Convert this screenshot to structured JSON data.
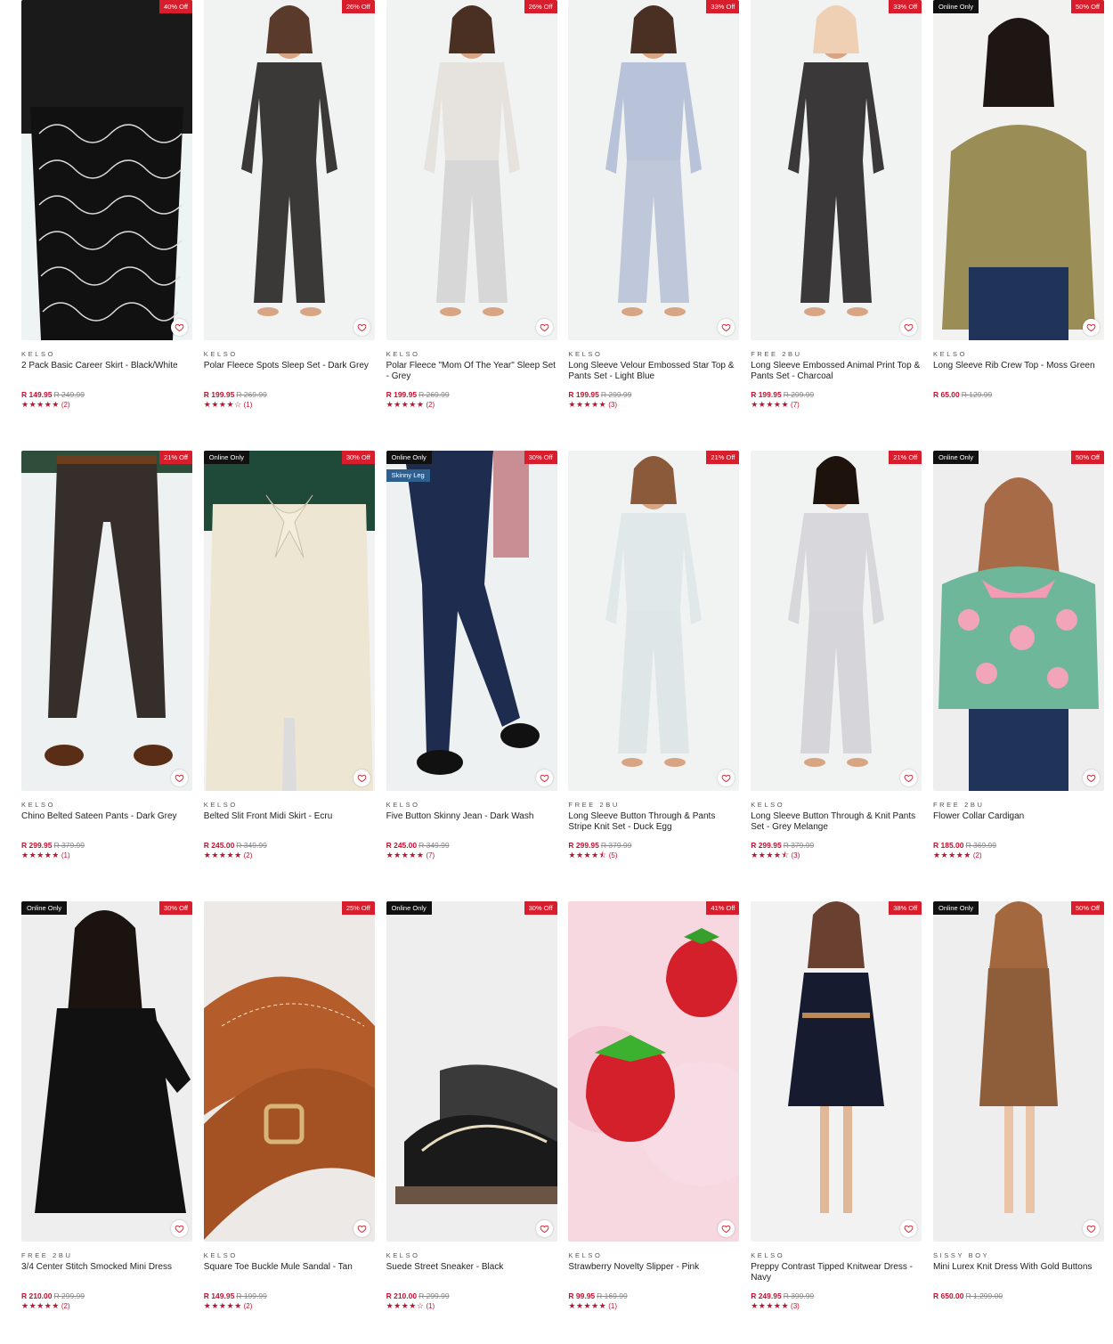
{
  "wishlist_icon": "heart-outline-icon",
  "rating_icon": "star-icon",
  "colors": {
    "sale_red": "#d81e2c",
    "price_red": "#c8102e",
    "online_black": "#111111",
    "tag_blue": "#2f5f8f"
  },
  "products": [
    {
      "brand": "KELSO",
      "name": "2 Pack Basic Career Skirt - Black/White",
      "price": "R 149.95",
      "was": "R 249.99",
      "discount": "40% Off",
      "online_only": false,
      "tag": "",
      "stars": 5,
      "reviews": "(2)"
    },
    {
      "brand": "KELSO",
      "name": "Polar Fleece Spots Sleep Set - Dark Grey",
      "price": "R 199.95",
      "was": "R 269.99",
      "discount": "26% Off",
      "online_only": false,
      "tag": "",
      "stars": 4,
      "reviews": "(1)"
    },
    {
      "brand": "KELSO",
      "name": "Polar Fleece \"Mom Of The Year\" Sleep Set - Grey",
      "price": "R 199.95",
      "was": "R 269.99",
      "discount": "26% Off",
      "online_only": false,
      "tag": "",
      "stars": 5,
      "reviews": "(2)"
    },
    {
      "brand": "KELSO",
      "name": "Long Sleeve Velour Embossed Star Top & Pants Set - Light Blue",
      "price": "R 199.95",
      "was": "R 299.99",
      "discount": "33% Off",
      "online_only": false,
      "tag": "",
      "stars": 5,
      "reviews": "(3)"
    },
    {
      "brand": "FREE 2BU",
      "name": "Long Sleeve Embossed Animal Print Top & Pants Set - Charcoal",
      "price": "R 199.95",
      "was": "R 299.99",
      "discount": "33% Off",
      "online_only": false,
      "tag": "",
      "stars": 5,
      "reviews": "(7)"
    },
    {
      "brand": "KELSO",
      "name": "Long Sleeve Rib Crew Top - Moss Green",
      "price": "R 65.00",
      "was": "R 129.99",
      "discount": "50% Off",
      "online_only": true,
      "tag": "",
      "stars": null,
      "reviews": ""
    },
    {
      "brand": "KELSO",
      "name": "Chino Belted Sateen Pants - Dark Grey",
      "price": "R 299.95",
      "was": "R 379.99",
      "discount": "21% Off",
      "online_only": false,
      "tag": "",
      "stars": 5,
      "reviews": "(1)"
    },
    {
      "brand": "KELSO",
      "name": "Belted Slit Front Midi Skirt - Ecru",
      "price": "R 245.00",
      "was": "R 349.99",
      "discount": "30% Off",
      "online_only": true,
      "tag": "",
      "stars": 5,
      "reviews": "(2)"
    },
    {
      "brand": "KELSO",
      "name": "Five Button Skinny Jean - Dark Wash",
      "price": "R 245.00",
      "was": "R 349.99",
      "discount": "30% Off",
      "online_only": true,
      "tag": "Skinny Leg",
      "stars": 5,
      "reviews": "(7)"
    },
    {
      "brand": "FREE 2BU",
      "name": "Long Sleeve Button Through & Pants Stripe Knit Set - Duck Egg",
      "price": "R 299.95",
      "was": "R 379.99",
      "discount": "21% Off",
      "online_only": false,
      "tag": "",
      "stars": 4.5,
      "reviews": "(5)"
    },
    {
      "brand": "KELSO",
      "name": "Long Sleeve Button Through & Knit Pants Set - Grey Melange",
      "price": "R 299.95",
      "was": "R 379.99",
      "discount": "21% Off",
      "online_only": false,
      "tag": "",
      "stars": 4.5,
      "reviews": "(3)"
    },
    {
      "brand": "FREE 2BU",
      "name": "Flower Collar Cardigan",
      "price": "R 185.00",
      "was": "R 369.99",
      "discount": "50% Off",
      "online_only": true,
      "tag": "",
      "stars": 5,
      "reviews": "(2)"
    },
    {
      "brand": "FREE 2BU",
      "name": "3/4 Center Stitch Smocked Mini Dress",
      "price": "R 210.00",
      "was": "R 299.99",
      "discount": "30% Off",
      "online_only": true,
      "tag": "",
      "stars": 5,
      "reviews": "(2)"
    },
    {
      "brand": "KELSO",
      "name": "Square Toe Buckle Mule Sandal - Tan",
      "price": "R 149.95",
      "was": "R 199.99",
      "discount": "25% Off",
      "online_only": false,
      "tag": "",
      "stars": 5,
      "reviews": "(2)"
    },
    {
      "brand": "KELSO",
      "name": "Suede Street Sneaker - Black",
      "price": "R 210.00",
      "was": "R 299.99",
      "discount": "30% Off",
      "online_only": true,
      "tag": "",
      "stars": 4,
      "reviews": "(1)"
    },
    {
      "brand": "KELSO",
      "name": "Strawberry Novelty Slipper - Pink",
      "price": "R 99.95",
      "was": "R 169.99",
      "discount": "41% Off",
      "online_only": false,
      "tag": "",
      "stars": 5,
      "reviews": "(1)"
    },
    {
      "brand": "KELSO",
      "name": "Preppy Contrast Tipped Knitwear Dress - Navy",
      "price": "R 249.95",
      "was": "R 399.99",
      "discount": "38% Off",
      "online_only": false,
      "tag": "",
      "stars": 5,
      "reviews": "(3)"
    },
    {
      "brand": "SISSY BOY",
      "name": "Mini Lurex Knit Dress With Gold Buttons",
      "price": "R 650.00",
      "was": "R 1,299.00",
      "discount": "50% Off",
      "online_only": true,
      "tag": "",
      "stars": null,
      "reviews": ""
    }
  ],
  "labels": {
    "online_only": "Online Only"
  }
}
